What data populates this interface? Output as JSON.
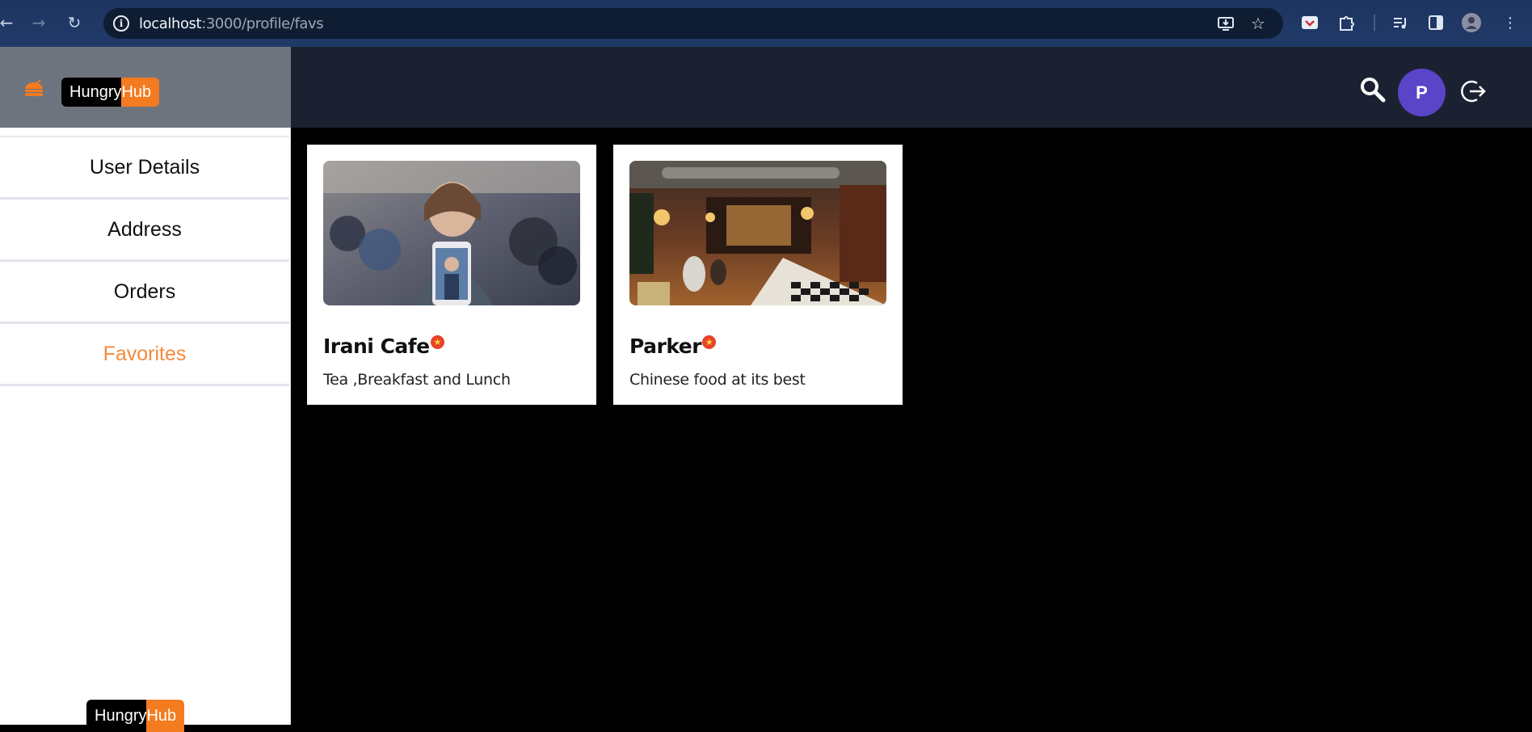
{
  "browser": {
    "url_host": "localhost",
    "url_path": ":3000/profile/favs"
  },
  "header": {
    "logo_part1": "Hungry",
    "logo_part2": "Hub",
    "avatar_initial": "P"
  },
  "sidebar": {
    "items": [
      {
        "label": "User Details",
        "active": false
      },
      {
        "label": "Address",
        "active": false
      },
      {
        "label": "Orders",
        "active": false
      },
      {
        "label": "Favorites",
        "active": true
      }
    ],
    "footer_logo_part1": "Hungry",
    "footer_logo_part2": "Hub"
  },
  "favorites": [
    {
      "name": "Irani Cafe",
      "description": "Tea ,Breakfast and Lunch"
    },
    {
      "name": "Parker",
      "description": "Chinese food at its best"
    }
  ],
  "colors": {
    "accent": "#f47b20",
    "avatar": "#5a45c9",
    "header_bg": "#1b2130",
    "brand_panel": "#6e747e"
  },
  "icons": {
    "search": "search-icon",
    "logout": "logout-icon",
    "brand": "burger-icon",
    "favorite_badge": "star-badge-icon"
  }
}
